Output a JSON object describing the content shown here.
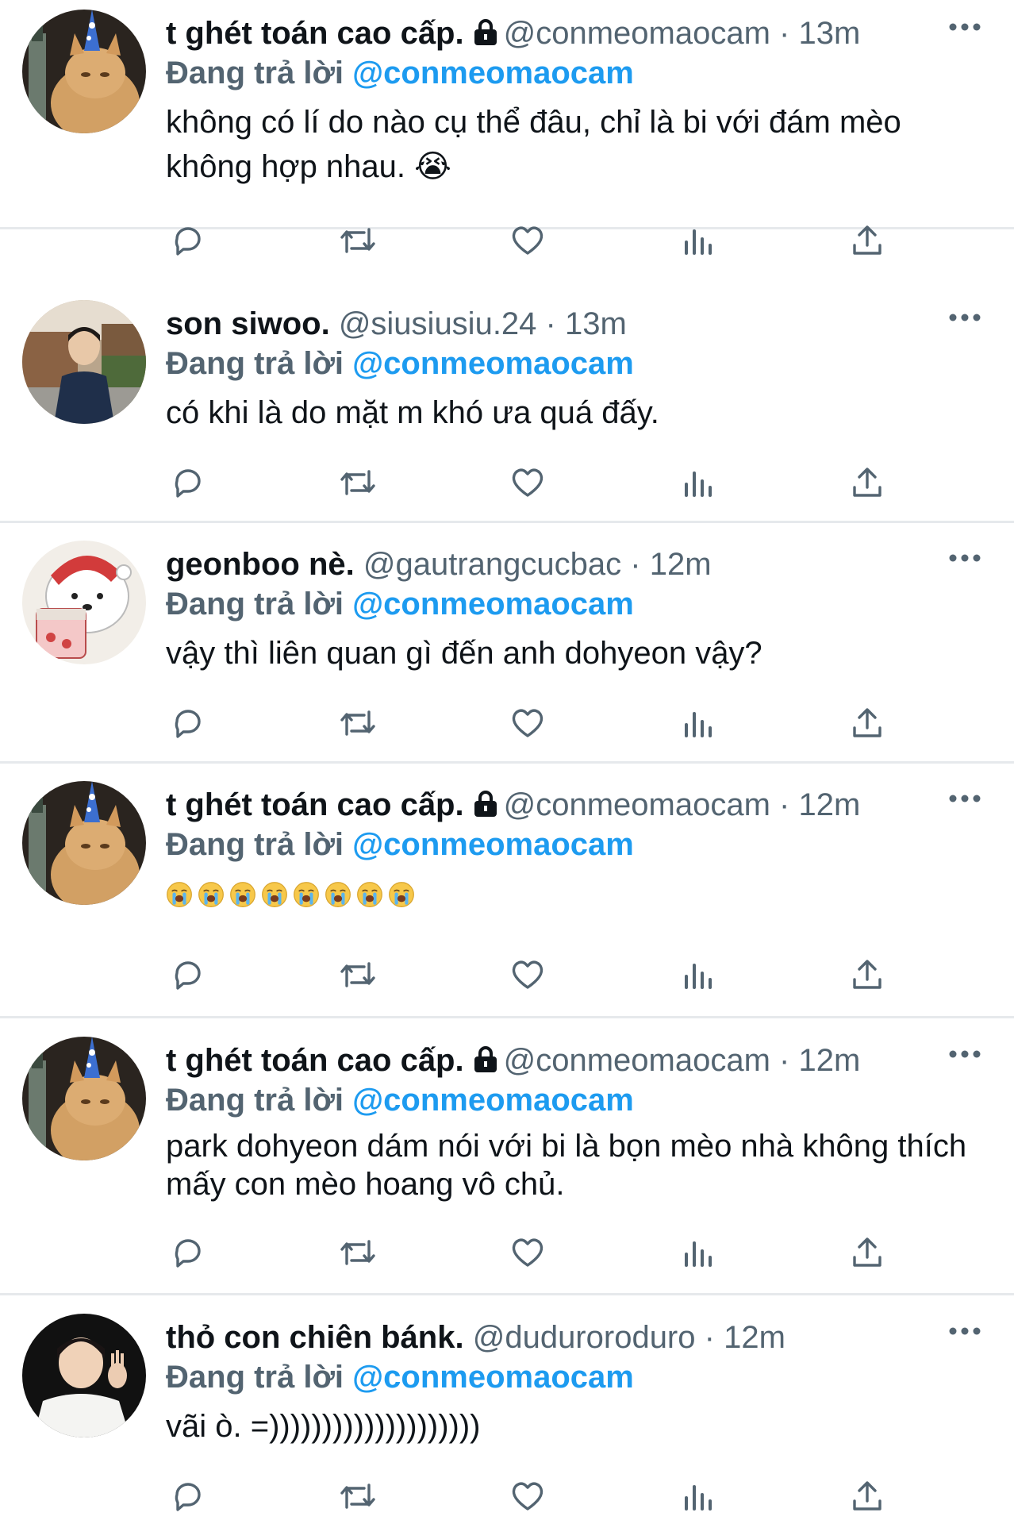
{
  "colors": {
    "text": "#0f1419",
    "muted": "#536471",
    "accent": "#1d9bf0",
    "divider": "#e6e9ec"
  },
  "reply_prefix": "Đang trả lời",
  "tweets": [
    {
      "display_name": "t ghét toán cao cấp.",
      "locked": true,
      "handle": "@conmeomaocam",
      "separator": "·",
      "time": "13m",
      "reply_to": "@conmeomaocam",
      "text": "không có lí do nào cụ thể đâu, chỉ là bi với đám mèo không hợp nhau. 😭",
      "avatar": "orange-cat-party-hat"
    },
    {
      "display_name": "son siwoo.",
      "locked": false,
      "handle": "@siusiusiu.24",
      "separator": "·",
      "time": "13m",
      "reply_to": "@conmeomaocam",
      "text": "có khi là do mặt m khó ưa quá đấy.",
      "avatar": "young-man-street"
    },
    {
      "display_name": "geonboo nè.",
      "locked": false,
      "handle": "@gautrangcucbac",
      "separator": "·",
      "time": "12m",
      "reply_to": "@conmeomaocam",
      "text": "vậy thì liên quan gì đến anh dohyeon vậy?",
      "avatar": "polar-bear-ice-cream"
    },
    {
      "display_name": "t ghét toán cao cấp.",
      "locked": true,
      "handle": "@conmeomaocam",
      "separator": "·",
      "time": "12m",
      "reply_to": "@conmeomaocam",
      "text": "😭😭😭😭😭😭😭😭",
      "emoji_count": 8,
      "avatar": "orange-cat-party-hat"
    },
    {
      "display_name": "t ghét toán cao cấp.",
      "locked": true,
      "handle": "@conmeomaocam",
      "separator": "·",
      "time": "12m",
      "reply_to": "@conmeomaocam",
      "text": "park dohyeon dám nói với bi là bọn mèo nhà không thích mấy con mèo hoang vô chủ.",
      "avatar": "orange-cat-party-hat"
    },
    {
      "display_name": "thỏ con chiên bánk.",
      "locked": false,
      "handle": "@duduroroduro",
      "separator": "·",
      "time": "12m",
      "reply_to": "@conmeomaocam",
      "text": "vãi ò. =))))))))))))))))))))",
      "avatar": "young-man-waving"
    }
  ]
}
